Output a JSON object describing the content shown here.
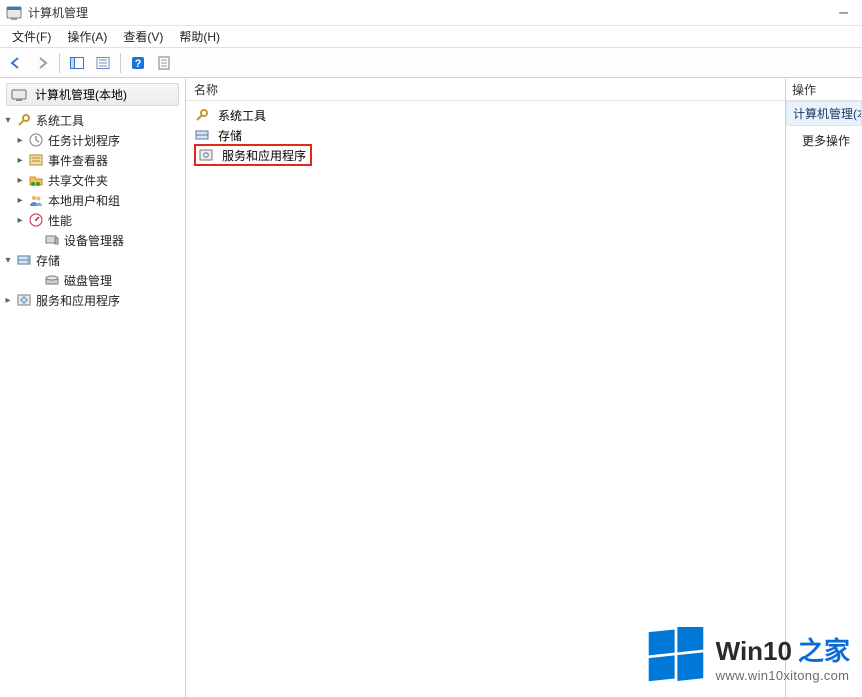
{
  "window": {
    "title": "计算机管理",
    "minimize_label": "–"
  },
  "menu": {
    "file": "文件(F)",
    "action": "操作(A)",
    "view": "查看(V)",
    "help": "帮助(H)"
  },
  "toolbar": {
    "back": "back",
    "forward": "forward",
    "up_grid": "up-grid",
    "tree_toggle": "tree-toggle",
    "help": "help",
    "sheet": "sheet"
  },
  "tree": {
    "root": "计算机管理(本地)",
    "nodes": {
      "system_tools": "系统工具",
      "task_scheduler": "任务计划程序",
      "event_viewer": "事件查看器",
      "shared_folders": "共享文件夹",
      "local_users_groups": "本地用户和组",
      "performance": "性能",
      "device_manager": "设备管理器",
      "storage": "存储",
      "disk_management": "磁盘管理",
      "services_apps": "服务和应用程序"
    }
  },
  "list": {
    "column_name": "名称",
    "items": {
      "system_tools": "系统工具",
      "storage": "存储",
      "services_apps": "服务和应用程序"
    }
  },
  "actions": {
    "header": "操作",
    "section_title": "计算机管理(本地)",
    "more_actions": "更多操作"
  },
  "watermark": {
    "brand_main": "Win10",
    "brand_accent": "之家",
    "url": "www.win10xitong.com"
  }
}
